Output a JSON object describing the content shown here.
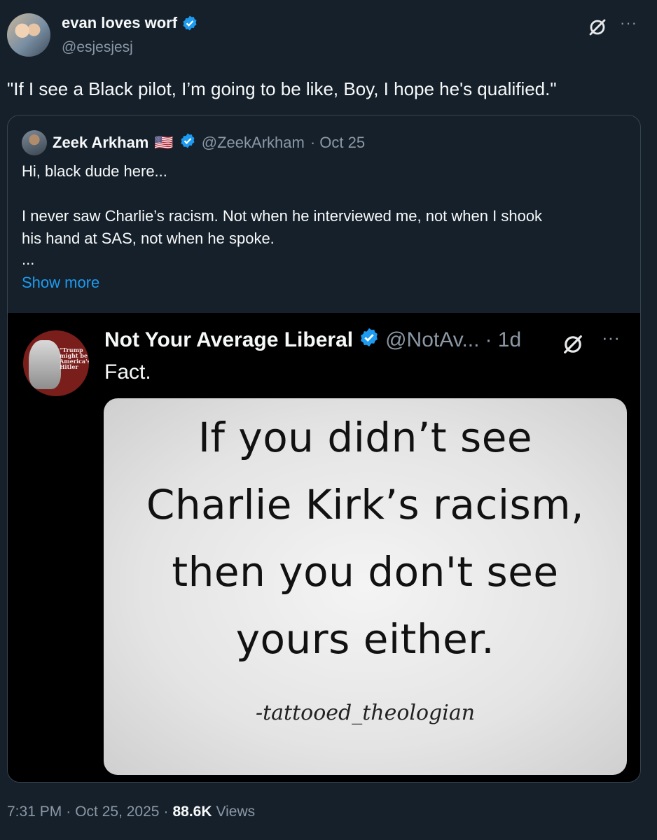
{
  "tweet": {
    "author_name": "evan loves worf",
    "author_handle": "@esjesjesj",
    "text": "\"If I see a Black pilot, I’m going to be like, Boy, I hope he's qualified.\"",
    "more_label": "···",
    "time": "7:31 PM",
    "date": "Oct 25, 2025",
    "separator": "·",
    "views_count": "88.6K",
    "views_label": "Views"
  },
  "quoted": {
    "author_name": "Zeek Arkham",
    "flag": "🇺🇸",
    "author_handle": "@ZeekArkham",
    "date": "· Oct 25",
    "line1": "Hi, black dude here...",
    "line2": "I never saw Charlie’s racism. Not when he interviewed me, not when I shook",
    "line3": "his hand at SAS, not when he spoke.",
    "ellipsis": "...",
    "show_more": "Show more"
  },
  "embedded": {
    "avatar_text": "\"Trump might be America's Hitler",
    "author_name": "Not Your Average Liberal",
    "author_handle": "@NotAv...",
    "age": "· 1d",
    "more_label": "···",
    "text": "Fact.",
    "image_lines": [
      "If you didn’t see",
      "Charlie Kirk’s racism,",
      "then you don't see",
      "yours either."
    ],
    "image_signature": "-tattooed_theologian"
  },
  "colors": {
    "background": "#15202b",
    "accent": "#1d9bf0",
    "secondary_text": "#8b98a5",
    "border": "#38444d"
  },
  "icons": [
    "verified-badge-icon",
    "grok-icon",
    "more-icon",
    "us-flag-icon"
  ]
}
